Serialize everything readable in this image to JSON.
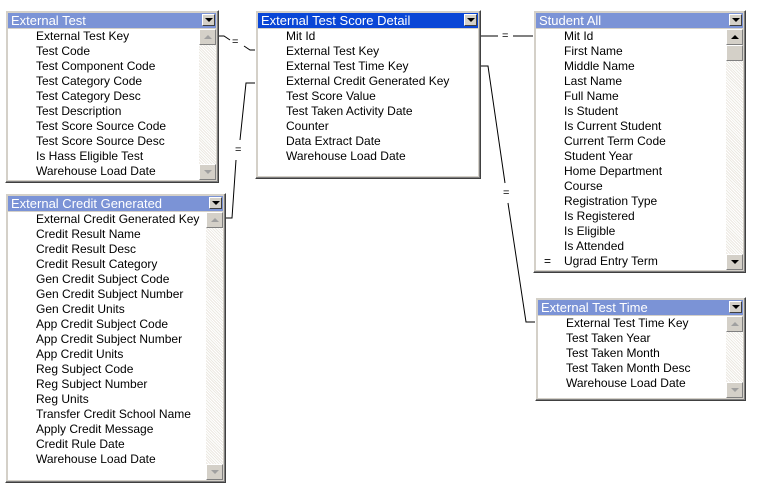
{
  "tables": [
    {
      "title": "External Test",
      "active": false,
      "rows": [
        {
          "label": "External Test Key"
        },
        {
          "label": "Test Code"
        },
        {
          "label": "Test Component Code"
        },
        {
          "label": "Test Category Code"
        },
        {
          "label": "Test Category Desc"
        },
        {
          "label": "Test Description"
        },
        {
          "label": "Test Score Source Code"
        },
        {
          "label": "Test Score Source Desc"
        },
        {
          "label": "Is Hass Eligible Test"
        },
        {
          "label": "Warehouse Load Date"
        }
      ],
      "scrollbar": "disabled"
    },
    {
      "title": "External Test Score Detail",
      "active": true,
      "rows": [
        {
          "label": "Mit Id"
        },
        {
          "label": "External Test Key"
        },
        {
          "label": "External Test Time Key"
        },
        {
          "label": "External Credit Generated Key"
        },
        {
          "label": "Test Score Value"
        },
        {
          "label": "Test Taken Activity Date"
        },
        {
          "label": "Counter"
        },
        {
          "label": "Data Extract Date"
        },
        {
          "label": "Warehouse Load Date"
        }
      ],
      "scrollbar": "none"
    },
    {
      "title": "Student All",
      "active": false,
      "rows": [
        {
          "label": "Mit Id"
        },
        {
          "label": "First Name"
        },
        {
          "label": "Middle Name"
        },
        {
          "label": "Last Name"
        },
        {
          "label": "Full Name"
        },
        {
          "label": "Is Student"
        },
        {
          "label": "Is Current Student"
        },
        {
          "label": "Current Term Code"
        },
        {
          "label": "Student Year"
        },
        {
          "label": "Home Department"
        },
        {
          "label": "Course"
        },
        {
          "label": "Registration Type"
        },
        {
          "label": "Is Registered"
        },
        {
          "label": "Is Eligible"
        },
        {
          "label": "Is Attended"
        },
        {
          "label": "Ugrad Entry Term",
          "mark": "="
        }
      ],
      "scrollbar": "enabled"
    },
    {
      "title": "External Credit Generated",
      "active": false,
      "rows": [
        {
          "label": "External Credit Generated Key"
        },
        {
          "label": "Credit Result Name"
        },
        {
          "label": "Credit Result Desc"
        },
        {
          "label": "Credit Result Category"
        },
        {
          "label": "Gen Credit Subject Code"
        },
        {
          "label": "Gen Credit Subject Number"
        },
        {
          "label": "Gen Credit Units"
        },
        {
          "label": "App Credit Subject Code"
        },
        {
          "label": "App Credit Subject Number"
        },
        {
          "label": "App Credit Units"
        },
        {
          "label": "Reg Subject Code"
        },
        {
          "label": "Reg Subject Number"
        },
        {
          "label": "Reg Units"
        },
        {
          "label": "Transfer Credit School Name"
        },
        {
          "label": "Apply Credit Message"
        },
        {
          "label": "Credit Rule Date"
        },
        {
          "label": "Warehouse Load Date"
        }
      ],
      "scrollbar": "disabled"
    },
    {
      "title": "External Test Time",
      "active": false,
      "rows": [
        {
          "label": "External Test Time Key"
        },
        {
          "label": "Test Taken Year"
        },
        {
          "label": "Test Taken Month"
        },
        {
          "label": "Test Taken Month Desc"
        },
        {
          "label": "Warehouse Load Date"
        }
      ],
      "scrollbar": "disabled"
    }
  ],
  "joins": [
    {
      "from": "External Test.External Test Key",
      "to": "External Test Score Detail.External Test Key",
      "operator": "="
    },
    {
      "from": "External Credit Generated.External Credit Generated Key",
      "to": "External Test Score Detail.External Credit Generated Key",
      "operator": "="
    },
    {
      "from": "External Test Score Detail.Mit Id",
      "to": "Student All.Mit Id",
      "operator": "="
    },
    {
      "from": "External Test Score Detail.External Test Time Key",
      "to": "External Test Time.External Test Time Key",
      "operator": "="
    }
  ],
  "colors": {
    "header_inactive": "#7b93d6",
    "header_active": "#0a46d6"
  }
}
